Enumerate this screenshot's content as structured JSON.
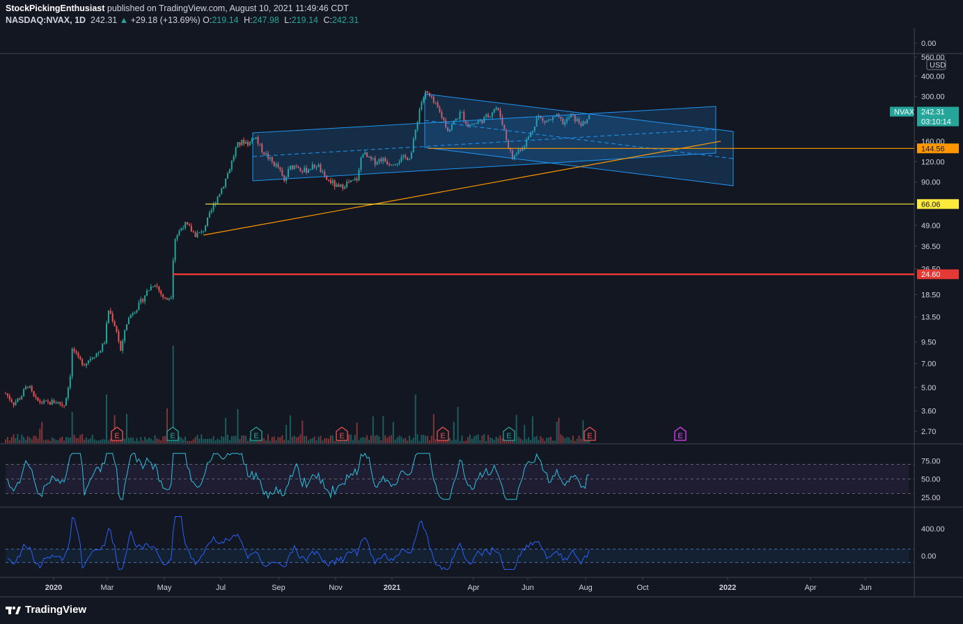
{
  "header": {
    "publisher": "StockPickingEnthusiast",
    "published_text": "published on TradingView.com, August 10, 2021 11:49:46 CDT",
    "symbol": "NASDAQ:NVAX, 1D",
    "last": "242.31",
    "change": "+29.18 (+13.69%)",
    "o_label": "O:",
    "o_value": "219.14",
    "h_label": "H:",
    "h_value": "247.98",
    "l_label": "L:",
    "l_value": "219.14",
    "c_label": "C:",
    "c_value": "242.31"
  },
  "footer": {
    "brand": "TradingView"
  },
  "colors": {
    "background": "#131722",
    "up": "#26a69a",
    "down": "#ef5350",
    "channel": "#2196f3",
    "orange": "#ff9800",
    "yellow": "#ffeb3b",
    "red_level": "#e53935",
    "rsi": "#2ec4e0",
    "cci": "#2962ff"
  },
  "chart_data": {
    "type": "candlestick",
    "symbol": "NVAX",
    "currency": "USD",
    "y_scale": "log",
    "y_ticks": [
      "0.00",
      "560.00",
      "400.00",
      "300.00",
      "160.00",
      "120.00",
      "90.00",
      "66.06",
      "49.00",
      "36.50",
      "26.50",
      "18.50",
      "13.50",
      "9.50",
      "7.00",
      "5.00",
      "3.60",
      "2.70"
    ],
    "x_ticks": [
      "2020",
      "Mar",
      "May",
      "Jul",
      "Sep",
      "Nov",
      "2021",
      "Apr",
      "Jun",
      "Aug",
      "Oct",
      "2022",
      "Apr",
      "Jun"
    ],
    "price_labels": [
      {
        "text": "NVAX",
        "value": 242.31,
        "color": "#26a69a"
      },
      {
        "text": "242.31",
        "value": 242.31,
        "color": "#26a69a"
      },
      {
        "text": "03:10:14",
        "value": 242.31,
        "color": "#26a69a"
      },
      {
        "text": "144.56",
        "value": 144.56,
        "color": "#ff9800"
      },
      {
        "text": "66.06",
        "value": 66.06,
        "color": "#ffeb3b"
      },
      {
        "text": "24.60",
        "value": 24.6,
        "color": "#e53935"
      }
    ],
    "horizontal_levels": [
      {
        "value": 144.56,
        "color": "#ff9800"
      },
      {
        "value": 66.06,
        "color": "#ffeb3b"
      },
      {
        "value": 24.6,
        "color": "#e53935"
      }
    ],
    "earnings_markers": [
      {
        "label": "E",
        "color": "#ef5350"
      },
      {
        "label": "E",
        "color": "#26a69a"
      },
      {
        "label": "E",
        "color": "#26a69a"
      },
      {
        "label": "E",
        "color": "#ef5350"
      },
      {
        "label": "E",
        "color": "#ef5350"
      },
      {
        "label": "E",
        "color": "#26a69a"
      },
      {
        "label": "E",
        "color": "#ef5350"
      },
      {
        "label": "E",
        "color": "#e040fb"
      }
    ],
    "rsi": {
      "ticks": [
        "75.00",
        "50.00",
        "25.00"
      ],
      "upper": 70,
      "middle": 50,
      "lower": 30
    },
    "cci": {
      "ticks": [
        "400.00",
        "0.00"
      ],
      "upper": 100,
      "lower": -100
    }
  }
}
